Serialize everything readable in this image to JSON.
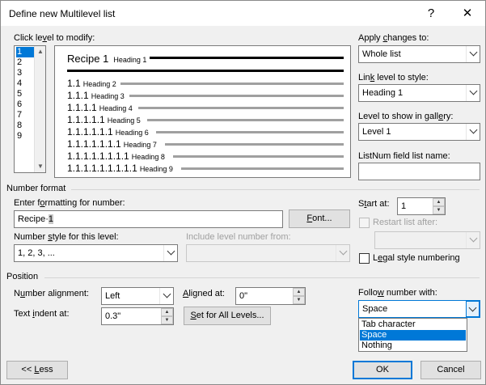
{
  "window": {
    "title": "Define new Multilevel list",
    "help_glyph": "?",
    "close_glyph": "✕"
  },
  "levels": {
    "label": "Click level to modify:",
    "items": [
      "1",
      "2",
      "3",
      "4",
      "5",
      "6",
      "7",
      "8",
      "9"
    ],
    "selected": "1"
  },
  "preview": {
    "first_number": "Recipe 1",
    "first_name": "Heading 1",
    "rows": [
      {
        "num": "1.1",
        "name": "Heading 2"
      },
      {
        "num": "1.1.1",
        "name": "Heading 3"
      },
      {
        "num": "1.1.1.1",
        "name": "Heading 4"
      },
      {
        "num": "1.1.1.1.1",
        "name": "Heading 5"
      },
      {
        "num": "1.1.1.1.1.1",
        "name": "Heading 6"
      },
      {
        "num": "1.1.1.1.1.1.1",
        "name": "Heading 7"
      },
      {
        "num": "1.1.1.1.1.1.1.1",
        "name": "Heading 8"
      },
      {
        "num": "1.1.1.1.1.1.1.1.1",
        "name": "Heading 9"
      }
    ]
  },
  "right_panel": {
    "apply_label": "Apply changes to:",
    "apply_value": "Whole list",
    "link_label": "Link level to style:",
    "link_value": "Heading 1",
    "gallery_label": "Level to show in gallery:",
    "gallery_value": "Level 1",
    "listnum_label": "ListNum field list name:",
    "listnum_value": ""
  },
  "number_format": {
    "section": "Number format",
    "enter_label": "Enter formatting for number:",
    "format_value": "Recipe",
    "format_dot": "·",
    "format_number": "1",
    "font_button": "Font...",
    "style_label": "Number style for this level:",
    "style_value": "1, 2, 3, ...",
    "include_label": "Include level number from:",
    "include_value": "",
    "start_label": "Start at:",
    "start_value": "1",
    "restart_label": "Restart list after:",
    "restart_value": "",
    "legal_label": "Legal style numbering",
    "legal_checked": false,
    "restart_checked": false
  },
  "position": {
    "section": "Position",
    "alignment_label": "Number alignment:",
    "alignment_value": "Left",
    "aligned_at_label": "Aligned at:",
    "aligned_at_value": "0\"",
    "indent_label": "Text indent at:",
    "indent_value": "0.3\"",
    "set_all_button": "Set for All Levels...",
    "follow_label": "Follow number with:",
    "follow_value": "Space",
    "follow_options": [
      "Tab character",
      "Space",
      "Nothing"
    ],
    "follow_selected": "Space"
  },
  "footer": {
    "less_button": "<< Less",
    "ok_button": "OK",
    "cancel_button": "Cancel"
  },
  "colors": {
    "selection": "#0078d7",
    "dialog_bg": "#f0f0f0",
    "titlebar_bg": "#ffffff"
  }
}
